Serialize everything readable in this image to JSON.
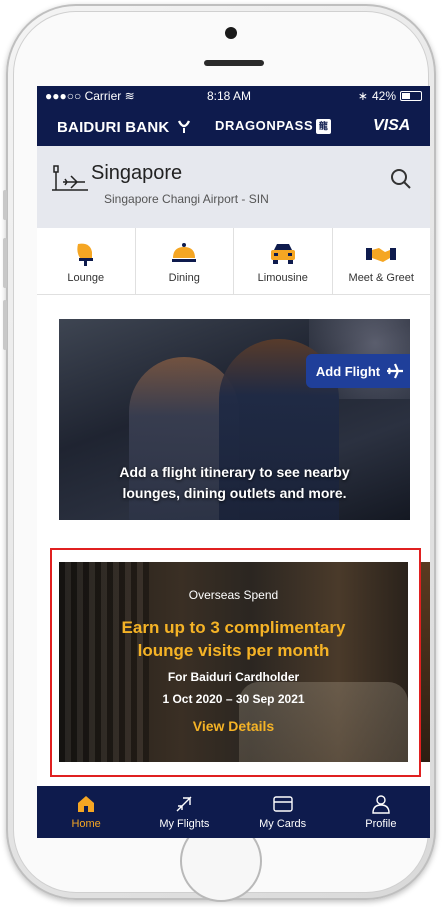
{
  "status": {
    "carrier": "●●●○○ Carrier",
    "time": "8:18 AM",
    "battery": "42%"
  },
  "brands": {
    "bank": "BAIDURI BANK",
    "partner": "DRAGONPASS",
    "partner_mark": "龍",
    "card": "VISA"
  },
  "location": {
    "city": "Singapore",
    "airport": "Singapore Changi Airport - SIN"
  },
  "services": [
    {
      "label": "Lounge",
      "icon": "lounge-chair-icon"
    },
    {
      "label": "Dining",
      "icon": "dining-cloche-icon"
    },
    {
      "label": "Limousine",
      "icon": "car-icon"
    },
    {
      "label": "Meet & Greet",
      "icon": "handshake-icon"
    }
  ],
  "flight_banner": {
    "button_label": "Add Flight",
    "message_line1": "Add a flight itinerary to see nearby",
    "message_line2": "lounges, dining outlets and more."
  },
  "promo": {
    "eyebrow": "Overseas Spend",
    "headline_line1": "Earn up to 3 complimentary",
    "headline_line2": "lounge visits per month",
    "audience": "For Baiduri Cardholder",
    "dates": "1 Oct 2020 – 30 Sep 2021",
    "cta": "View Details"
  },
  "tabs": [
    {
      "label": "Home",
      "icon": "home-icon",
      "active": true
    },
    {
      "label": "My Flights",
      "icon": "plane-icon",
      "active": false
    },
    {
      "label": "My Cards",
      "icon": "card-icon",
      "active": false
    },
    {
      "label": "Profile",
      "icon": "person-icon",
      "active": false
    }
  ],
  "colors": {
    "navy": "#0e1b4d",
    "accent": "#f5b326",
    "active_tab": "#f5a623",
    "add_flight_button": "#1f3f9a",
    "highlight_border": "#e02020"
  }
}
